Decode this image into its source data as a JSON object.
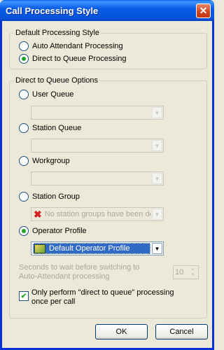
{
  "window": {
    "title": "Call Processing Style"
  },
  "default_group": {
    "legend": "Default Processing Style",
    "options": [
      "Auto Attendant Processing",
      "Direct to Queue Processing"
    ],
    "selected": 1
  },
  "dq_group": {
    "legend": "Direct to Queue Options",
    "user_queue": {
      "label": "User Queue",
      "value": ""
    },
    "station_queue": {
      "label": "Station Queue",
      "value": ""
    },
    "workgroup": {
      "label": "Workgroup",
      "value": ""
    },
    "station_group": {
      "label": "Station Group",
      "value": "No station groups have been de"
    },
    "operator_profile": {
      "label": "Operator Profile",
      "value": "Default Operator Profile",
      "selected": true
    }
  },
  "wait": {
    "label_line1": "Seconds to wait before switching to",
    "label_line2": "Auto-Attendant processing",
    "value": "10"
  },
  "once_per_call": {
    "line1": "Only perform \"direct to queue\" processing",
    "line2": "once per call",
    "checked": true
  },
  "buttons": {
    "ok": "OK",
    "cancel": "Cancel"
  },
  "icons": {
    "close": "close-icon",
    "error": "red-x-icon",
    "profile": "operator-profile-icon"
  }
}
